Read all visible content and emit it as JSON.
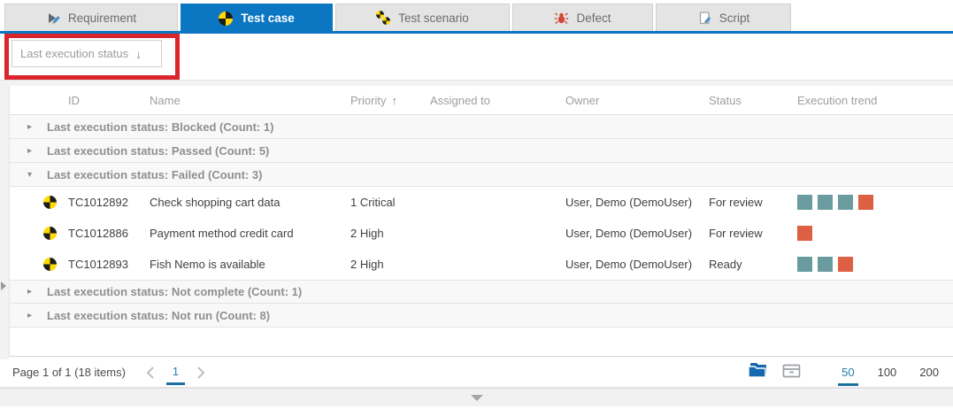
{
  "colors": {
    "passed": "#6a9c9f",
    "failed": "#dd5f44",
    "accent_blue": "#0b76c1",
    "annotation_red": "#d9252b"
  },
  "tabs": [
    {
      "label": "Requirement",
      "icon": "requirement-icon",
      "active": false
    },
    {
      "label": "Test case",
      "icon": "test-case-icon",
      "active": true
    },
    {
      "label": "Test scenario",
      "icon": "test-scenario-icon",
      "active": false
    },
    {
      "label": "Defect",
      "icon": "defect-icon",
      "active": false
    },
    {
      "label": "Script",
      "icon": "script-icon",
      "active": false
    }
  ],
  "toolbar": {
    "group_by": {
      "value": "Last execution status",
      "arrow": "↓"
    }
  },
  "grid": {
    "columns": {
      "id": "ID",
      "name": "Name",
      "priority": "Priority",
      "assigned": "Assigned to",
      "owner": "Owner",
      "status": "Status",
      "trend": "Execution trend"
    },
    "sort": {
      "column": "Priority",
      "direction": "ascending",
      "arrow": "↑"
    },
    "groups": [
      {
        "label": "Last execution status: Blocked (Count: 1)",
        "expanded": false
      },
      {
        "label": "Last execution status: Passed (Count: 5)",
        "expanded": false
      },
      {
        "label": "Last execution status: Failed (Count: 3)",
        "expanded": true,
        "rows": [
          {
            "id": "TC1012892",
            "name": "Check shopping cart data",
            "priority": "1 Critical",
            "assigned_to": "",
            "owner": "User, Demo (DemoUser)",
            "status": "For review",
            "trend": [
              "passed",
              "passed",
              "passed",
              "failed"
            ]
          },
          {
            "id": "TC1012886",
            "name": "Payment method credit card",
            "priority": "2 High",
            "assigned_to": "",
            "owner": "User, Demo (DemoUser)",
            "status": "For review",
            "trend": [
              "failed"
            ]
          },
          {
            "id": "TC1012893",
            "name": "Fish Nemo is available",
            "priority": "2 High",
            "assigned_to": "",
            "owner": "User, Demo (DemoUser)",
            "status": "Ready",
            "trend": [
              "passed",
              "passed",
              "failed"
            ]
          }
        ]
      },
      {
        "label": "Last execution status: Not complete (Count: 1)",
        "expanded": false
      },
      {
        "label": "Last execution status: Not run (Count: 8)",
        "expanded": false
      }
    ]
  },
  "footer": {
    "page_info": "Page 1 of 1 (18 items)",
    "current_page": "1",
    "page_sizes": [
      "50",
      "100",
      "200"
    ],
    "selected_page_size": "50",
    "icons": [
      "copy-folders-icon",
      "archive-box-icon"
    ]
  }
}
